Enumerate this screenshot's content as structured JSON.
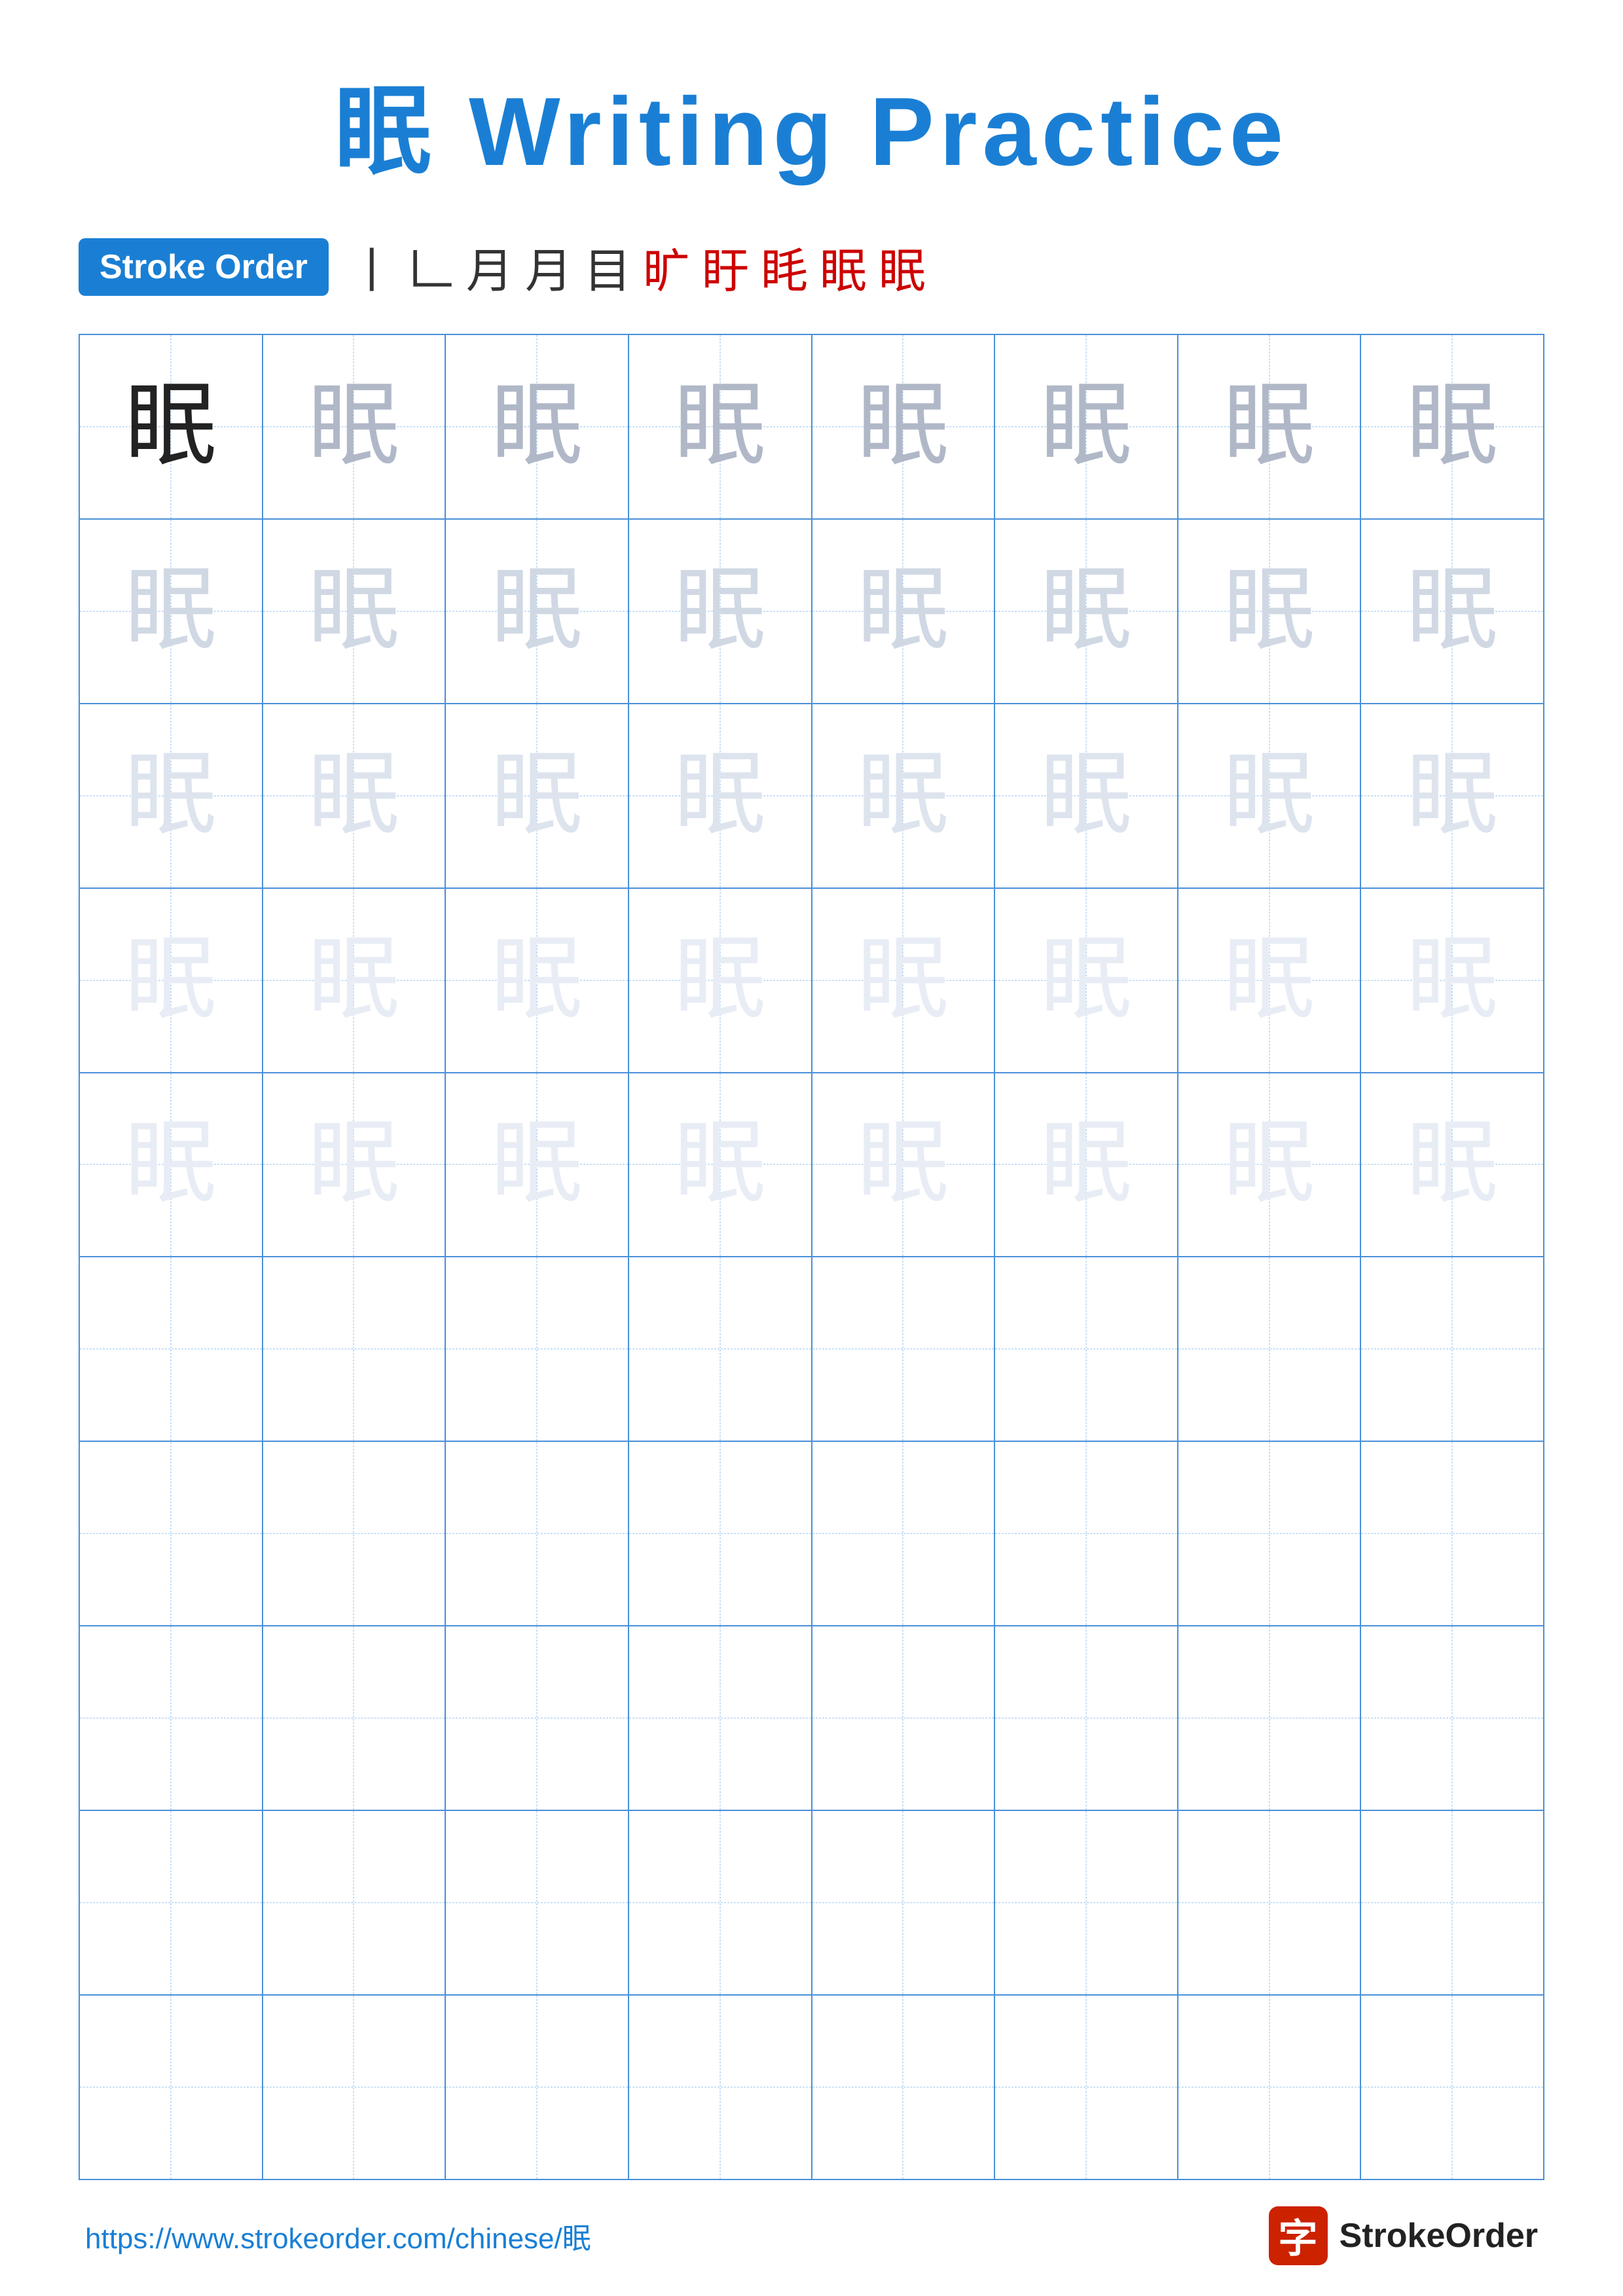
{
  "title": "眠 Writing Practice",
  "stroke_order_label": "Stroke Order",
  "stroke_sequence": [
    "丨",
    "𠃊",
    "月",
    "月",
    "目",
    "旷",
    "盱",
    "眊",
    "眠",
    "眠"
  ],
  "stroke_sequence_colors": [
    "dark",
    "dark",
    "dark",
    "dark",
    "dark",
    "red",
    "red",
    "red",
    "red",
    "red"
  ],
  "character": "眠",
  "grid": {
    "rows": 10,
    "cols": 8,
    "cells": [
      [
        "dark",
        "medium",
        "medium",
        "medium",
        "medium",
        "medium",
        "medium",
        "medium"
      ],
      [
        "light",
        "light",
        "light",
        "light",
        "light",
        "light",
        "light",
        "light"
      ],
      [
        "lighter",
        "lighter",
        "lighter",
        "lighter",
        "lighter",
        "lighter",
        "lighter",
        "lighter"
      ],
      [
        "lightest",
        "lightest",
        "lightest",
        "lightest",
        "lightest",
        "lightest",
        "lightest",
        "lightest"
      ],
      [
        "lightest",
        "lightest",
        "lightest",
        "lightest",
        "lightest",
        "lightest",
        "lightest",
        "lightest"
      ],
      [
        "empty",
        "empty",
        "empty",
        "empty",
        "empty",
        "empty",
        "empty",
        "empty"
      ],
      [
        "empty",
        "empty",
        "empty",
        "empty",
        "empty",
        "empty",
        "empty",
        "empty"
      ],
      [
        "empty",
        "empty",
        "empty",
        "empty",
        "empty",
        "empty",
        "empty",
        "empty"
      ],
      [
        "empty",
        "empty",
        "empty",
        "empty",
        "empty",
        "empty",
        "empty",
        "empty"
      ],
      [
        "empty",
        "empty",
        "empty",
        "empty",
        "empty",
        "empty",
        "empty",
        "empty"
      ]
    ]
  },
  "footer": {
    "url": "https://www.strokeorder.com/chinese/眠",
    "logo_char": "字",
    "logo_text": "StrokeOrder"
  }
}
